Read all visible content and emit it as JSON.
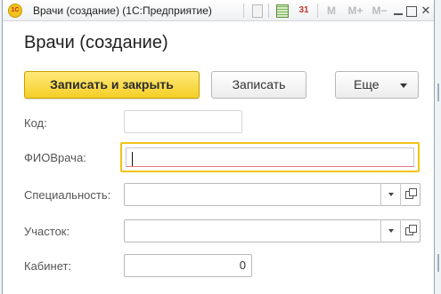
{
  "window": {
    "title": "Врачи (создание)  (1С:Предприятие)",
    "app_logo": "1С"
  },
  "toolbar": {
    "calendar_day": "31",
    "m_label": "M",
    "mplus_label": "M+",
    "mminus_label": "M−",
    "close_label": "✕",
    "icons": [
      "document-icon",
      "calculator-icon",
      "calendar-icon",
      "minimize-icon",
      "maximize-icon",
      "close-icon"
    ]
  },
  "form": {
    "title": "Врачи (создание)",
    "buttons": {
      "save_close": "Записать и закрыть",
      "save": "Записать",
      "more": "Еще"
    },
    "fields": {
      "kod": {
        "label": "Код:",
        "value": ""
      },
      "fio": {
        "label": "ФИОВрача:",
        "value": ""
      },
      "spec": {
        "label": "Специальность:",
        "value": ""
      },
      "uchastok": {
        "label": "Участок:",
        "value": ""
      },
      "kabinet": {
        "label": "Кабинет:",
        "value": "0"
      }
    }
  },
  "colors": {
    "primary_button": "#f5cf27",
    "focus_border": "#f2c318"
  }
}
